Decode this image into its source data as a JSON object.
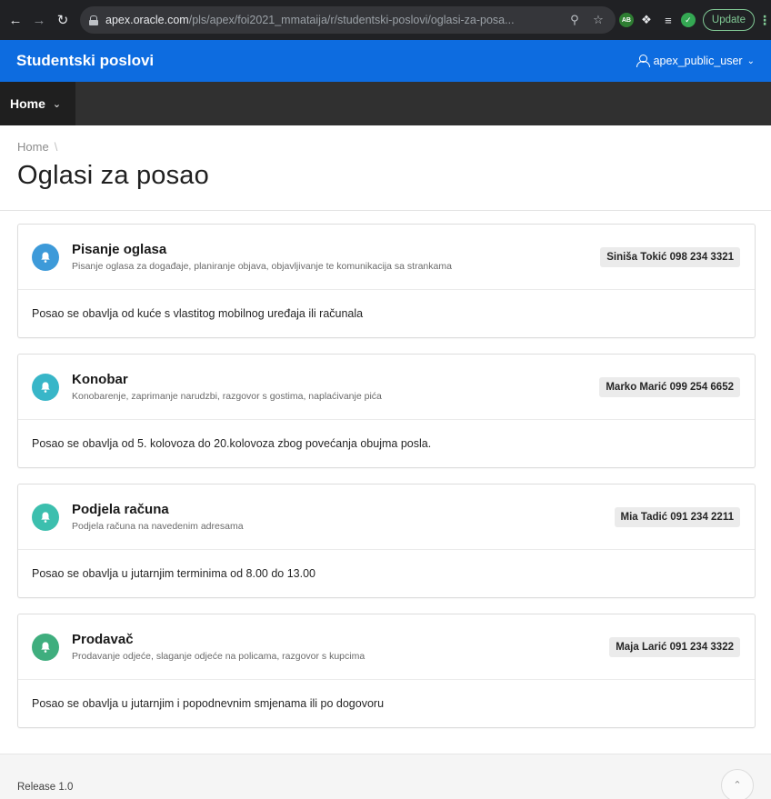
{
  "browser": {
    "url_host": "apex.oracle.com",
    "url_path": "/pls/apex/foi2021_mmataija/r/studentski-poslovi/oglasi-za-posa...",
    "extension_label": "AB",
    "update_label": "Update"
  },
  "header": {
    "app_title": "Studentski poslovi",
    "user_name": "apex_public_user"
  },
  "nav": {
    "home_label": "Home"
  },
  "breadcrumb": {
    "home": "Home",
    "separator": "\\"
  },
  "page": {
    "title": "Oglasi za posao"
  },
  "jobs": [
    {
      "title": "Pisanje oglasa",
      "description": "Pisanje oglasa za događaje, planiranje objava, objavljivanje te komunikacija sa strankama",
      "contact": "Siniša Tokić 098 234 3321",
      "details": "Posao se obavlja od kuće s vlastitog mobilnog uređaja ili računala",
      "icon": "bell-icon",
      "icon_color": "#3d9ad9"
    },
    {
      "title": "Konobar",
      "description": "Konobarenje, zaprimanje narudzbi, razgovor s gostima, naplaćivanje pića",
      "contact": "Marko Marić 099 254 6652",
      "details": "Posao se obavlja od 5. kolovoza do 20.kolovoza zbog povećanja obujma posla.",
      "icon": "bell-icon",
      "icon_color": "#38b6c8"
    },
    {
      "title": "Podjela računa",
      "description": "Podjela računa na navedenim adresama",
      "contact": "Mia Tadić 091 234 2211",
      "details": "Posao se obavlja u jutarnjim terminima od 8.00 do 13.00",
      "icon": "bell-icon",
      "icon_color": "#3cbfae"
    },
    {
      "title": "Prodavač",
      "description": "Prodavanje odjeće, slaganje odjeće na policama, razgovor s kupcima",
      "contact": "Maja Larić 091 234 3322",
      "details": "Posao se obavlja u jutarnjim i popodnevnim smjenama ili po dogovoru",
      "icon": "bell-icon",
      "icon_color": "#3fae7e"
    }
  ],
  "footer": {
    "release": "Release 1.0"
  },
  "colors": {
    "header_blue": "#0d6ce0",
    "nav_dark": "#303030"
  }
}
